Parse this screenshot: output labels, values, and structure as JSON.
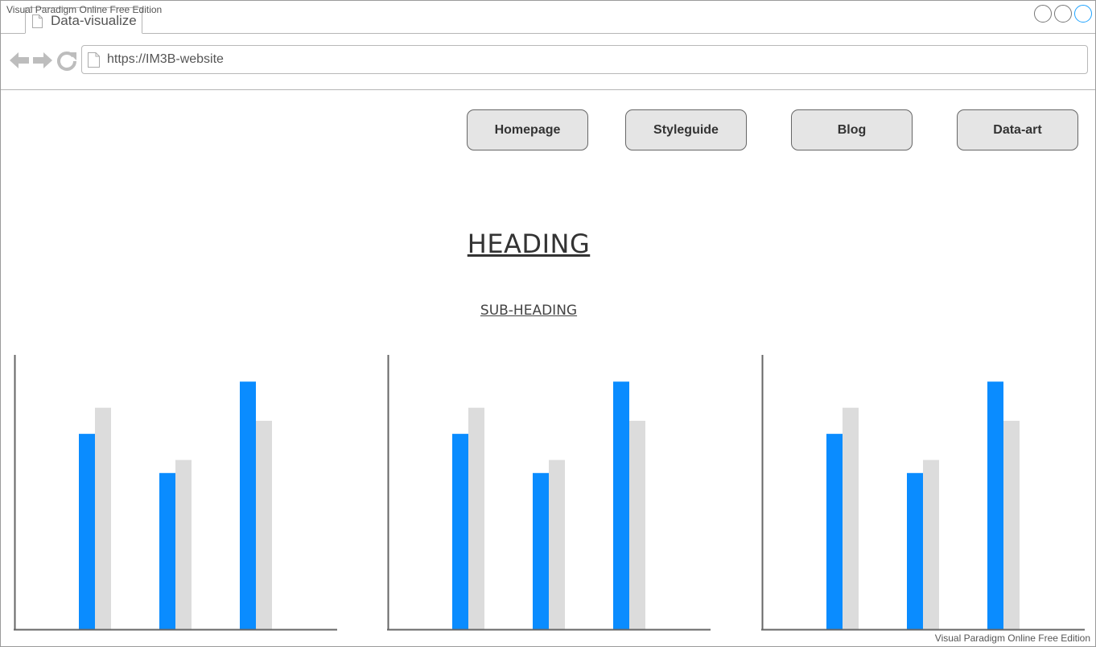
{
  "browser": {
    "watermark_top": "Visual Paradigm Online Free Edition",
    "tab_title": "Data-visualize",
    "url": "https://IM3B-website"
  },
  "icons": [
    "doc-icon",
    "back-arrow-icon",
    "forward-arrow-icon",
    "reload-icon",
    "window-control-icon"
  ],
  "nav": {
    "items": [
      {
        "label": "Homepage"
      },
      {
        "label": "Styleguide"
      },
      {
        "label": "Blog"
      },
      {
        "label": "Data-art"
      }
    ]
  },
  "content": {
    "heading": "HEADING",
    "subheading": "SUB-HEADING"
  },
  "colors": {
    "primary_series": "#0a8cff",
    "secondary_series": "#dcdcdc",
    "button_bg": "#e5e5e5"
  },
  "chart_data": [
    {
      "type": "bar",
      "categories": [
        "",
        "",
        ""
      ],
      "series": [
        {
          "values": [
            75,
            60,
            95
          ]
        },
        {
          "values": [
            85,
            65,
            80
          ]
        }
      ],
      "ylim": [
        0,
        100
      ],
      "grid": false
    },
    {
      "type": "bar",
      "categories": [
        "",
        "",
        ""
      ],
      "series": [
        {
          "values": [
            75,
            60,
            95
          ]
        },
        {
          "values": [
            85,
            65,
            80
          ]
        }
      ],
      "ylim": [
        0,
        100
      ],
      "grid": false
    },
    {
      "type": "bar",
      "categories": [
        "",
        "",
        ""
      ],
      "series": [
        {
          "values": [
            75,
            60,
            95
          ]
        },
        {
          "values": [
            85,
            65,
            80
          ]
        }
      ],
      "ylim": [
        0,
        100
      ],
      "grid": false
    }
  ],
  "footer": {
    "watermark_bottom": "Visual Paradigm Online Free Edition"
  }
}
